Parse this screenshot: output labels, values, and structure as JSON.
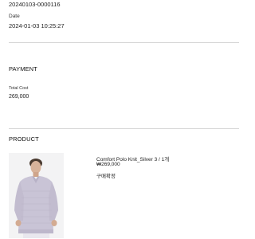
{
  "order": {
    "number": "20240103-0000116",
    "date_label": "Date",
    "date_value": "2024-01-03 10:25:27"
  },
  "payment": {
    "title": "PAYMENT",
    "total_label": "Total Cost",
    "total_value": "269,000"
  },
  "product": {
    "title": "PRODUCT",
    "name": "Comfort Polo Knit_Silver 3 / 1개",
    "price": "₩269,000",
    "status": "구매확정",
    "sweater_color": "#c9c4d6",
    "background_color": "#f3f3f4"
  }
}
